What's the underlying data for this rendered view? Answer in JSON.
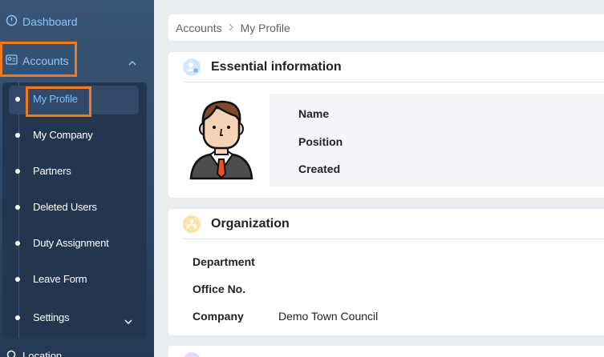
{
  "sidebar": {
    "dashboard_label": "Dashboard",
    "accounts_label": "Accounts",
    "submenu": [
      {
        "label": "My Profile"
      },
      {
        "label": "My Company"
      },
      {
        "label": "Partners"
      },
      {
        "label": "Deleted Users"
      },
      {
        "label": "Duty Assignment"
      },
      {
        "label": "Leave Form"
      },
      {
        "label": "Settings"
      }
    ],
    "next_item_label": "Location"
  },
  "breadcrumb": {
    "parent": "Accounts",
    "current": "My Profile"
  },
  "essential": {
    "title": "Essential information",
    "fields": [
      "Name",
      "Position",
      "Created"
    ]
  },
  "organization": {
    "title": "Organization",
    "fields": [
      "Department",
      "Office No.",
      "Company"
    ],
    "company_value": "Demo Town Council"
  },
  "colors": {
    "accent": "#8ec5f5",
    "highlight": "#f07b1e",
    "sidebar": "#2f4a69"
  }
}
